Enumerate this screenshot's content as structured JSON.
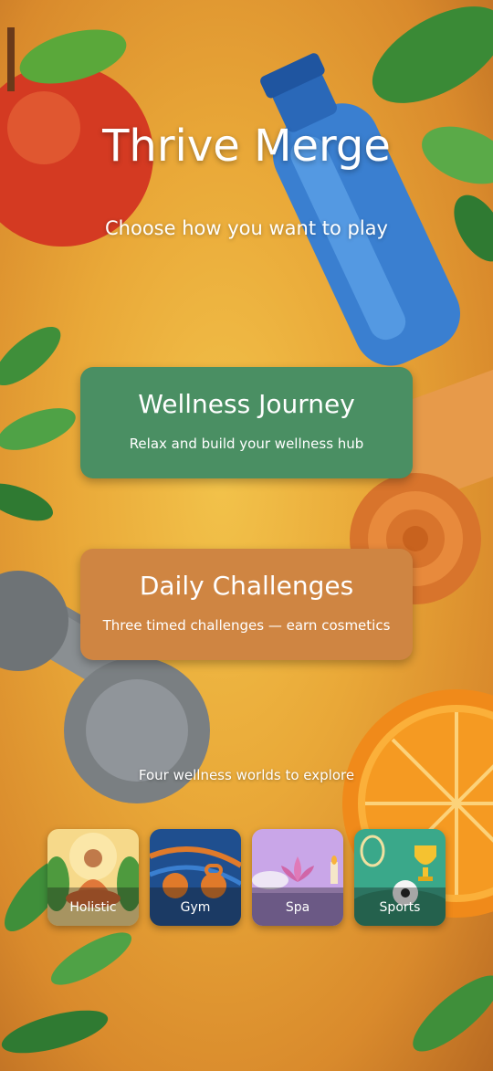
{
  "app": {
    "title": "Thrive Merge",
    "subtitle": "Choose how you want to play"
  },
  "modes": [
    {
      "title": "Wellness Journey",
      "description": "Relax and build your wellness hub",
      "color": "#4a8f63"
    },
    {
      "title": "Daily Challenges",
      "description": "Three timed challenges — earn cosmetics",
      "color": "#cf8542"
    }
  ],
  "worlds_caption": "Four wellness worlds to explore",
  "worlds": [
    {
      "label": "Holistic",
      "icon": "meditation-icon"
    },
    {
      "label": "Gym",
      "icon": "kettlebell-icon"
    },
    {
      "label": "Spa",
      "icon": "lotus-icon"
    },
    {
      "label": "Sports",
      "icon": "trophy-icon"
    }
  ],
  "background_items": [
    "apple-icon",
    "water-bottle-icon",
    "yoga-mat-icon",
    "dumbbell-icon",
    "orange-slice-icon",
    "leaf-icon"
  ]
}
